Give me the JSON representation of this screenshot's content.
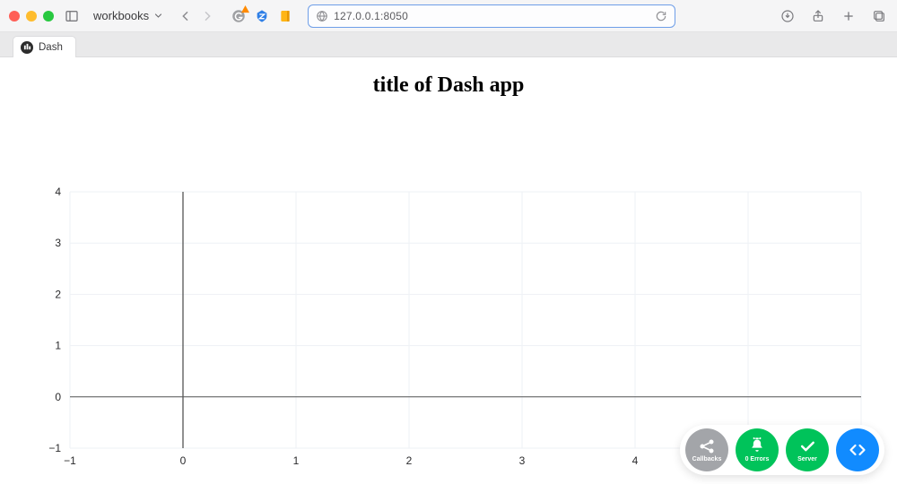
{
  "browser": {
    "bookmark_folder": "workbooks",
    "url": "127.0.0.1:8050",
    "tab_title": "Dash"
  },
  "page": {
    "title": "title of Dash app"
  },
  "chart_data": {
    "type": "line",
    "title": "",
    "xlabel": "",
    "ylabel": "",
    "xlim": [
      -1,
      6
    ],
    "ylim": [
      -1,
      4
    ],
    "xticks": [
      -1,
      0,
      1,
      2,
      3,
      4,
      5,
      6
    ],
    "yticks": [
      -1,
      0,
      1,
      2,
      3,
      4
    ],
    "series": []
  },
  "devtools": {
    "callbacks_label": "Callbacks",
    "errors_label": "0 Errors",
    "server_label": "Server"
  }
}
